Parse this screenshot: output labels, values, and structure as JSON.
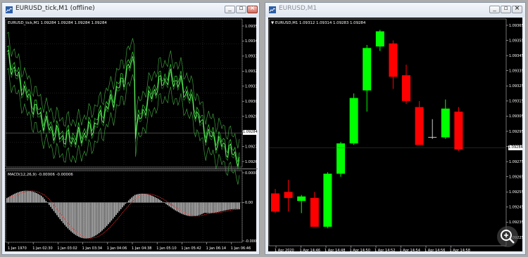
{
  "left_window": {
    "title": "EURUSD_tick,M1 (offline)",
    "chart_header": "EURUSD_tick,M1  1.09284 1.09284 1.09284 1.09284",
    "price_ticks": [
      "1.09355",
      "1.09345",
      "1.09335",
      "1.09325",
      "1.09315",
      "1.09305",
      "1.09295",
      "1.09285",
      "1.09275",
      "1.09265"
    ],
    "current_price": "1.09284",
    "macd_header": "MACD(12,26,9) -0.00006 -0.00006",
    "macd_ticks": [
      "0.00007",
      "0.00",
      "-0.00009"
    ],
    "time_ticks": [
      "1 Jan 1970",
      "1 Jan 02:30",
      "1 Jan 03:02",
      "1 Jan 03:34",
      "1 Jan 04:06",
      "1 Jan 04:38",
      "1 Jan 05:10",
      "1 Jan 05:42",
      "1 Jan 06:14",
      "1 Jan 06:46"
    ]
  },
  "right_window": {
    "title": "EURUSD,M1",
    "chart_header": "EURUSD,M1  1.09312 1.09314 1.09283 1.09284",
    "price_ticks": [
      "1.09365",
      "1.09355",
      "1.09345",
      "1.09335",
      "1.09325",
      "1.09315",
      "1.09305",
      "1.09295",
      "1.09285",
      "1.09275",
      "1.09265",
      "1.09255",
      "1.09245",
      "1.09235",
      "1.09225"
    ],
    "current_price": "1.09284",
    "time_ticks": [
      "1 Apr 2020",
      "1 Apr 14:46",
      "1 Apr 14:48",
      "1 Apr 14:50",
      "1 Apr 14:52",
      "1 Apr 14:54",
      "1 Apr 14:56",
      "1 Apr 14:58"
    ],
    "candles": [
      {
        "o": 1.09254,
        "h": 1.09257,
        "l": 1.09241,
        "c": 1.09242
      },
      {
        "o": 1.09255,
        "h": 1.09263,
        "l": 1.09242,
        "c": 1.09251
      },
      {
        "o": 1.09249,
        "h": 1.09253,
        "l": 1.09241,
        "c": 1.09252
      },
      {
        "o": 1.09251,
        "h": 1.09255,
        "l": 1.09232,
        "c": 1.09232
      },
      {
        "o": 1.09232,
        "h": 1.09268,
        "l": 1.09231,
        "c": 1.09267
      },
      {
        "o": 1.09267,
        "h": 1.09288,
        "l": 1.09265,
        "c": 1.09287
      },
      {
        "o": 1.09287,
        "h": 1.0932,
        "l": 1.09286,
        "c": 1.09317
      },
      {
        "o": 1.09322,
        "h": 1.09352,
        "l": 1.09308,
        "c": 1.0935
      },
      {
        "o": 1.09351,
        "h": 1.09362,
        "l": 1.09348,
        "c": 1.09361
      },
      {
        "o": 1.09353,
        "h": 1.09355,
        "l": 1.09323,
        "c": 1.09331
      },
      {
        "o": 1.09332,
        "h": 1.09339,
        "l": 1.09313,
        "c": 1.09315
      },
      {
        "o": 1.09311,
        "h": 1.09315,
        "l": 1.09286,
        "c": 1.09286
      },
      {
        "o": 1.09291,
        "h": 1.09303,
        "l": 1.0929,
        "c": 1.09291
      },
      {
        "o": 1.09291,
        "h": 1.09316,
        "l": 1.0929,
        "c": 1.0931
      },
      {
        "o": 1.09308,
        "h": 1.09311,
        "l": 1.09282,
        "c": 1.09283
      }
    ],
    "bull_color": "#00FF00",
    "bear_color": "#FF0000"
  },
  "zoom_icon": "magnifier-plus-icon"
}
